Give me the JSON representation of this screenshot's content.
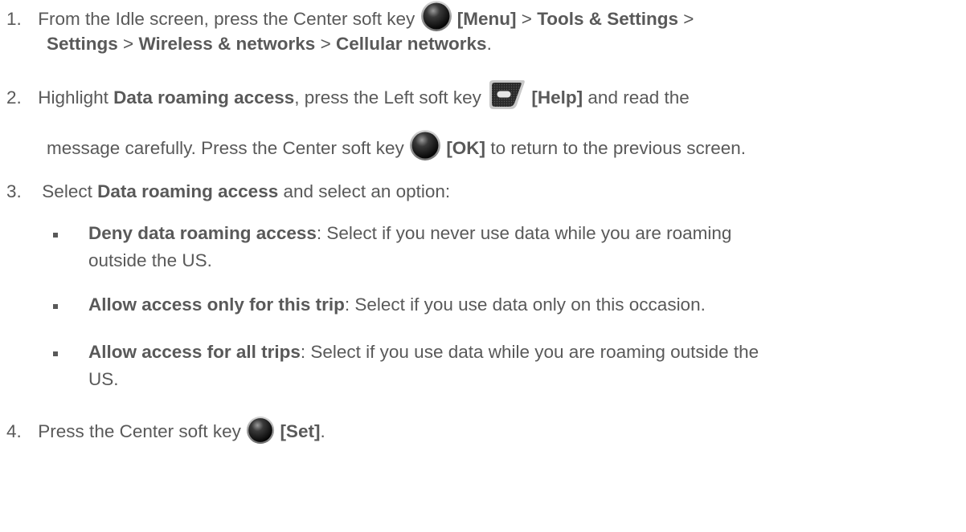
{
  "steps": [
    {
      "number": "1.",
      "line1_pre": "From the Idle screen, press the Center soft key",
      "line1_key_label": "[Menu]",
      "sep": ">",
      "item1": "Tools & Settings",
      "item2": "Settings",
      "item3": "Wireless & networks",
      "item4": "Cellular networks",
      "end": "."
    },
    {
      "number": "2.",
      "pre": "Highlight",
      "bold1": "Data roaming access",
      "mid": ", press the Left soft key",
      "key_label": "[Help]",
      "post": "and read the",
      "line2_pre": "message carefully. Press the Center soft key",
      "line2_key_label": "[OK]",
      "line2_post": "to return to the previous screen."
    },
    {
      "number": "3.",
      "pre": "Select",
      "bold1": "Data roaming access",
      "post": "and select an option:"
    },
    {
      "number": "4.",
      "pre": "Press the Center soft key",
      "key_label": "[Set]",
      "end": "."
    }
  ],
  "options": [
    {
      "title": "Deny data roaming access",
      "desc_line1": ": Select if you never use data while you are roaming",
      "desc_line2": "outside the US."
    },
    {
      "title": "Allow access only for this trip",
      "desc_line1": ": Select if you use data only on this occasion."
    },
    {
      "title": "Allow access for all trips",
      "desc_line1": ": Select if you use data while you are roaming outside the",
      "desc_line2": "US."
    }
  ],
  "icons": {
    "center_key": "center-soft-key-icon",
    "left_key": "left-soft-key-icon"
  }
}
